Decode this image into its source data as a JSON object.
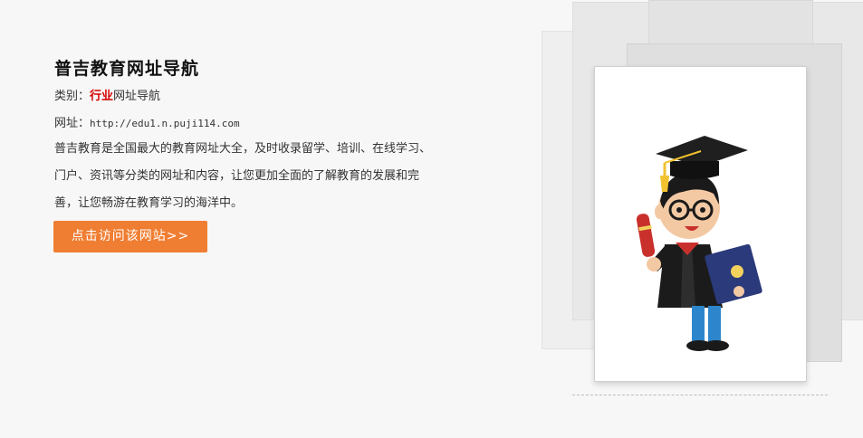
{
  "site": {
    "title": "普吉教育网址导航",
    "category_label": "类别：",
    "category_highlight": "行业",
    "category_rest": "网址导航",
    "url_label": "网址：",
    "url_value": "http://edu1.n.puji114.com",
    "description_lines": [
      "普吉教育是全国最大的教育网址大全，及时收录留学、培训、在线学习、",
      "门户、资讯等分类的网址和内容，让您更加全面的了解教育的发展和完",
      "善，让您畅游在教育学习的海洋中。"
    ],
    "visit_button": "点击访问该网站>>"
  },
  "colors": {
    "accent": "#f07e32",
    "highlight": "#d40000",
    "background": "#f7f7f7"
  },
  "illustration": {
    "icon": "graduate-cartoon-icon"
  }
}
